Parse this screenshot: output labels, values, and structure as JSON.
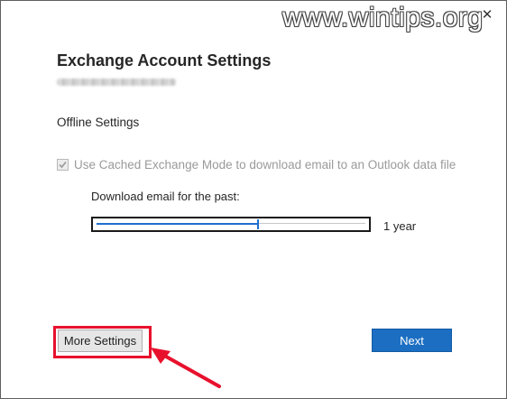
{
  "watermark": "www.wintips.org",
  "dialog": {
    "title": "Exchange Account Settings",
    "section_label": "Offline Settings",
    "cached_mode": {
      "label": "Use Cached Exchange Mode to download email to an Outlook data file",
      "checked": true,
      "disabled": true
    },
    "download_label": "Download email for the past:",
    "slider": {
      "value_label": "1 year",
      "position_fraction": 0.6
    },
    "buttons": {
      "more_settings": "More Settings",
      "next": "Next"
    }
  },
  "icons": {
    "close": "close-icon",
    "checkmark": "checkmark-icon",
    "pointer_arrow": "red-arrow-icon"
  },
  "colors": {
    "accent": "#1b6ec2",
    "highlight": "#e8112d",
    "disabled_text": "#9a9a9a"
  }
}
